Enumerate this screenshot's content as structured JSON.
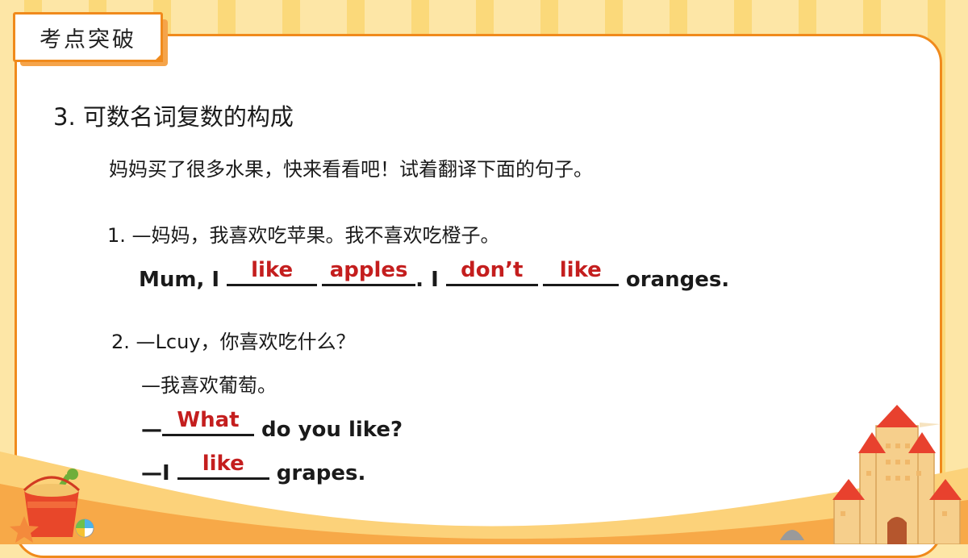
{
  "header": {
    "tag_label": "考点突破"
  },
  "section": {
    "title": "3. 可数名词复数的构成",
    "intro": "妈妈买了很多水果，快来看看吧！试着翻译下面的句子。"
  },
  "q1": {
    "prompt": "1. —妈妈，我喜欢吃苹果。我不喜欢吃橙子。",
    "en_start": "Mum, I ",
    "blank1": "like",
    "blank2": "apples",
    "en_mid": ". I ",
    "blank3": "don’t",
    "blank4": "like",
    "en_end": " oranges."
  },
  "q2": {
    "prompt": "2. —Lcuy，你喜欢吃什么？",
    "reply_cn": "—我喜欢葡萄。",
    "dash": "—",
    "blank1": "What",
    "line2_end": " do you like?",
    "line3_start": "—I ",
    "blank2": "like",
    "line3_end": " grapes."
  },
  "icons": [
    "sand-bucket-icon",
    "shovel-icon",
    "starfish-icon",
    "beach-ball-icon",
    "sandcastle-icon",
    "shell-icon"
  ],
  "colors": {
    "accent": "#f08a1c",
    "answer": "#c41e1e",
    "background": "#fde6a6"
  }
}
